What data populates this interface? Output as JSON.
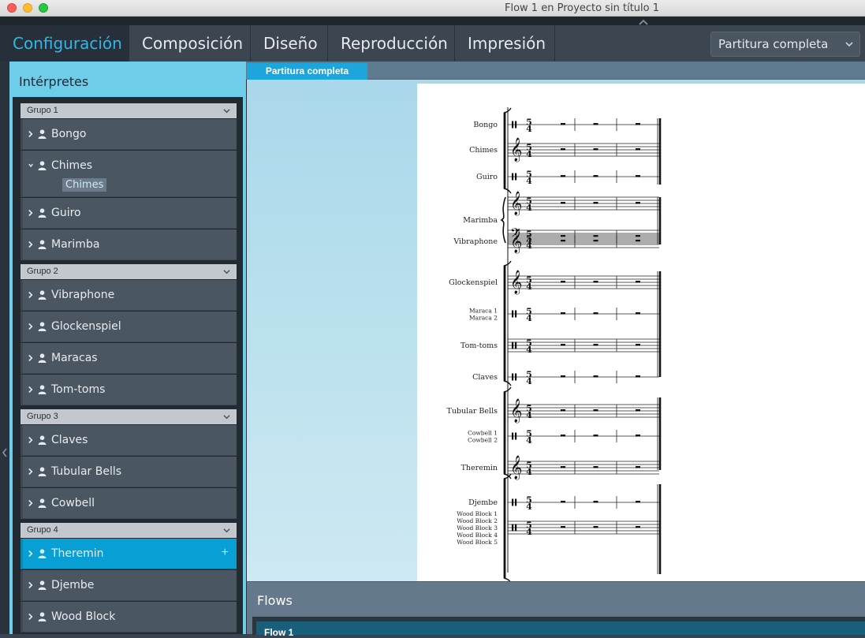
{
  "window": {
    "title": "Flow 1 en Proyecto sin título 1"
  },
  "modes": [
    {
      "label": "Configuración",
      "active": true
    },
    {
      "label": "Composición",
      "active": false
    },
    {
      "label": "Diseño",
      "active": false
    },
    {
      "label": "Reproducción",
      "active": false
    },
    {
      "label": "Impresión",
      "active": false
    }
  ],
  "layout_select": {
    "value": "Partitura completa"
  },
  "players_panel": {
    "title": "Intérpretes",
    "groups": [
      {
        "name": "Grupo 1",
        "players": [
          "Bongo",
          "Chimes",
          "Guiro",
          "Marimba"
        ]
      },
      {
        "name": "Grupo 2",
        "players": [
          "Vibraphone",
          "Glockenspiel",
          "Maracas",
          "Tom-toms"
        ]
      },
      {
        "name": "Grupo 3",
        "players": [
          "Claves",
          "Tubular Bells",
          "Cowbell"
        ]
      },
      {
        "name": "Grupo 4",
        "players": [
          "Theremin",
          "Djembe",
          "Wood Block"
        ]
      }
    ],
    "expanded_player": "Chimes",
    "expanded_instrument": "Chimes",
    "selected_player": "Theremin"
  },
  "layout_tab": {
    "label": "Partitura completa"
  },
  "score": {
    "time_signature": [
      "5",
      "4"
    ],
    "staves": [
      {
        "label": [
          "Bongo"
        ],
        "clef": "perc"
      },
      {
        "label": [
          "Chimes"
        ],
        "clef": "treble"
      },
      {
        "label": [
          "Guiro"
        ],
        "clef": "perc"
      },
      {
        "label": [
          "Marimba"
        ],
        "clef": "grand"
      },
      {
        "label": [
          "Vibraphone"
        ],
        "clef": "treble"
      },
      {
        "label": [
          "Glockenspiel"
        ],
        "clef": "treble"
      },
      {
        "label": [
          "Maraca 1",
          "Maraca 2"
        ],
        "clef": "perc"
      },
      {
        "label": [
          "Tom-toms"
        ],
        "clef": "perc5"
      },
      {
        "label": [
          "Claves"
        ],
        "clef": "perc"
      },
      {
        "label": [
          "Tubular Bells"
        ],
        "clef": "treble"
      },
      {
        "label": [
          "Cowbell 1",
          "Cowbell 2"
        ],
        "clef": "perc"
      },
      {
        "label": [
          "Theremin"
        ],
        "clef": "treble"
      },
      {
        "label": [
          "Djembe"
        ],
        "clef": "perc"
      },
      {
        "label": [
          "Wood Block 1",
          "Wood Block 2",
          "Wood Block 3",
          "Wood Block 4",
          "Wood Block 5"
        ],
        "clef": "perc5"
      }
    ]
  },
  "flows_panel": {
    "title": "Flows",
    "flow_name": "Flow 1"
  },
  "colors": {
    "accent": "#2db8e8",
    "selected_row": "#079fd4",
    "panel_bg": "#6ecde9"
  }
}
